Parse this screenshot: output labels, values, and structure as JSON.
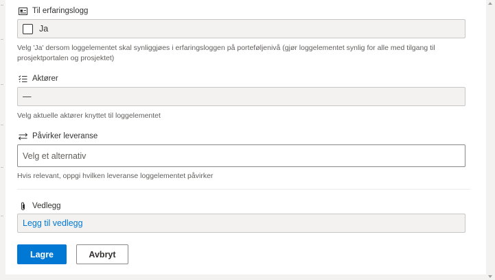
{
  "form": {
    "experience_log": {
      "label": "Til erfaringslogg",
      "icon": "checkbox-list-icon",
      "checkbox_label": "Ja",
      "checked": false,
      "help": "Velg 'Ja' dersom loggelementet skal synliggjøes i erfaringsloggen på porteføljenivå (gjør loggelementet synlig for alle med tilgang til prosjektportalen og prosjektet)"
    },
    "actors": {
      "label": "Aktører",
      "icon": "list-check-icon",
      "value": "—",
      "help": "Velg aktuelle aktører knyttet til loggelementet"
    },
    "deliverable": {
      "label": "Påvirker leveranse",
      "icon": "swap-arrows-icon",
      "placeholder": "Velg et alternativ",
      "help": "Hvis relevant, oppgi hvilken leveranse loggelementet påvirker"
    },
    "attachments": {
      "label": "Vedlegg",
      "icon": "paperclip-icon",
      "link": "Legg til vedlegg",
      "link_color": "#0078d4"
    }
  },
  "buttons": {
    "save": "Lagre",
    "cancel": "Avbryt",
    "primary_color": "#0078d4"
  }
}
